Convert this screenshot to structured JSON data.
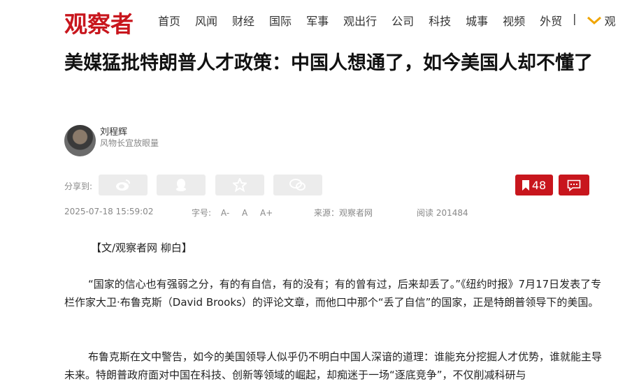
{
  "site": {
    "logo": "观察者"
  },
  "nav": {
    "items": [
      "首页",
      "风闻",
      "财经",
      "国际",
      "军事",
      "观出行",
      "公司",
      "科技",
      "城事",
      "视频",
      "外贸"
    ],
    "separator": "|",
    "more_label": "观"
  },
  "article": {
    "title": "美媒猛批特朗普人才政策：中国人想通了，如今美国人却不懂了",
    "author": {
      "name": "刘程辉",
      "tagline": "风物长宜放眼量"
    },
    "share_label": "分享到:",
    "bookmark_count": "48",
    "meta": {
      "datetime": "2025-07-18 15:59:02",
      "font_size_label": "字号:",
      "font_sizes": [
        "A-",
        "A",
        "A+"
      ],
      "source": "来源：观察者网",
      "reads": "阅读 201484"
    },
    "byline": "【文/观察者网 柳白】",
    "paragraphs": [
      "“国家的信心也有强弱之分，有的有自信，有的没有；有的曾有过，后来却丢了。”《纽约时报》7月17日发表了专栏作家大卫·布鲁克斯（David Brooks）的评论文章，而他口中那个“丢了自信”的国家，正是特朗普领导下的美国。",
      "布鲁克斯在文中警告，如今的美国领导人似乎仍不明白中国人深谙的道理：谁能充分挖掘人才优势，谁就能主导未来。特朗普政府面对中国在科技、创新等领域的崛起，却痴迷于一场“逐底竞争”，不仅削减科研与"
    ]
  },
  "colors": {
    "brand": "#c8161d",
    "share_bg": "#ececec",
    "meta_text": "#888888"
  },
  "icons": [
    "weibo-icon",
    "qq-icon",
    "qzone-star-icon",
    "wechat-icon",
    "bookmark-icon",
    "comment-icon",
    "chevron-down-icon"
  ]
}
